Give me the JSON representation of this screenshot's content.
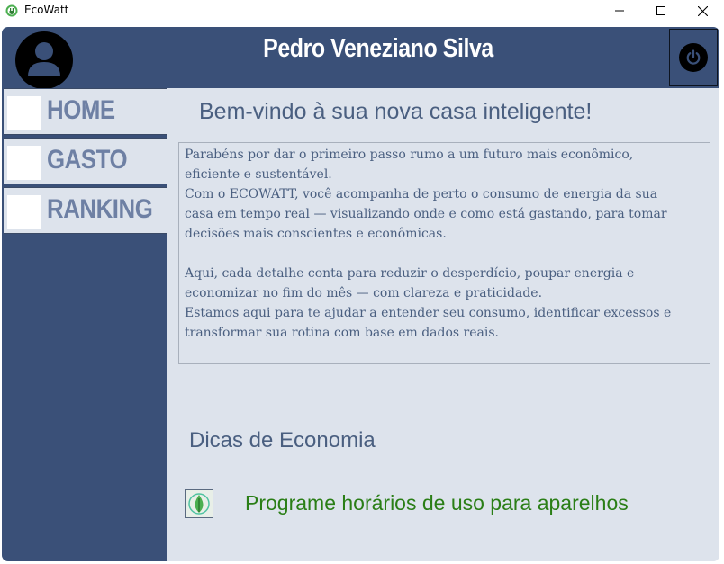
{
  "window": {
    "title": "EcoWatt",
    "icon": "plug-leaf-icon"
  },
  "header": {
    "user_name": "Pedro Veneziano Silva",
    "avatar_icon": "user-avatar-icon",
    "power_icon": "power-icon"
  },
  "sidebar": {
    "items": [
      {
        "label": "HOME"
      },
      {
        "label": "GASTO"
      },
      {
        "label": "RANKING"
      }
    ]
  },
  "main": {
    "welcome": "Bem-vindo à sua nova casa inteligente!",
    "intro_lines": [
      "Parabéns por dar o primeiro passo rumo a um futuro mais econômico,",
      "eficiente e sustentável.",
      "Com o ECOWATT, você acompanha de perto o consumo de energia da sua",
      "casa em tempo real — visualizando onde e como está gastando, para tomar",
      "decisões mais conscientes e econômicas.",
      "",
      "Aqui, cada detalhe conta para reduzir o desperdício, poupar energia e",
      "economizar no fim do mês — com clareza e praticidade.",
      "Estamos aqui para te ajudar a entender seu consumo, identificar excessos e",
      "transformar sua rotina com base em dados reais."
    ],
    "tips_title": "Dicas de Economia",
    "tip_icon": "leaf-drop-icon",
    "tip_text": "Programe horários de uso para aparelhos"
  },
  "colors": {
    "navy": "#3a5078",
    "panel": "#dde3ec",
    "text_blue": "#4a5f80",
    "tip_green": "#2a7e16",
    "nav_label": "#6e80a4"
  }
}
